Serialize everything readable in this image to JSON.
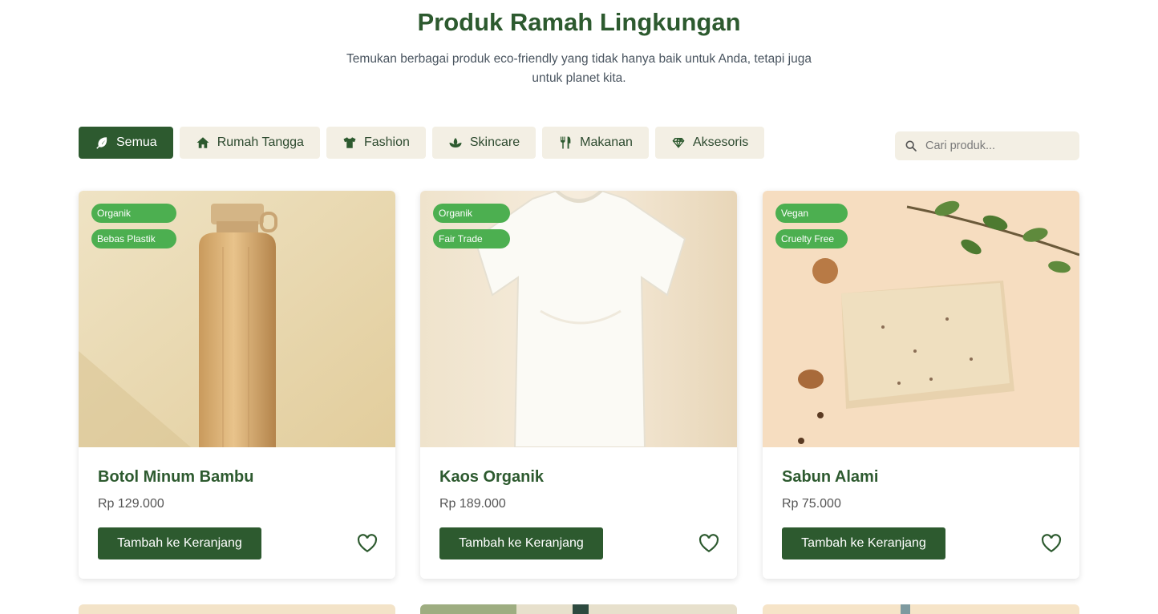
{
  "header": {
    "title": "Produk Ramah Lingkungan",
    "subtitle": "Temukan berbagai produk eco-friendly yang tidak hanya baik untuk Anda, tetapi juga untuk planet kita."
  },
  "filters": [
    {
      "label": "Semua",
      "icon": "leaf-icon",
      "active": true
    },
    {
      "label": "Rumah Tangga",
      "icon": "home-icon",
      "active": false
    },
    {
      "label": "Fashion",
      "icon": "shirt-icon",
      "active": false
    },
    {
      "label": "Skincare",
      "icon": "spa-icon",
      "active": false
    },
    {
      "label": "Makanan",
      "icon": "utensils-icon",
      "active": false
    },
    {
      "label": "Aksesoris",
      "icon": "gem-icon",
      "active": false
    }
  ],
  "search": {
    "placeholder": "Cari produk...",
    "icon": "search-icon"
  },
  "products": [
    {
      "name": "Botol Minum Bambu",
      "price": "Rp 129.000",
      "tags": [
        "Organik",
        "Bebas Plastik"
      ],
      "button": "Tambah ke Keranjang",
      "image": "bamboo-bottle-image"
    },
    {
      "name": "Kaos Organik",
      "price": "Rp 189.000",
      "tags": [
        "Organik",
        "Fair Trade"
      ],
      "button": "Tambah ke Keranjang",
      "image": "white-tshirt-image"
    },
    {
      "name": "Sabun Alami",
      "price": "Rp 75.000",
      "tags": [
        "Vegan",
        "Cruelty Free"
      ],
      "button": "Tambah ke Keranjang",
      "image": "natural-soap-image"
    }
  ],
  "colors": {
    "primary": "#2d5a2f",
    "tag": "#4caf50",
    "chip": "#f3efe4"
  }
}
